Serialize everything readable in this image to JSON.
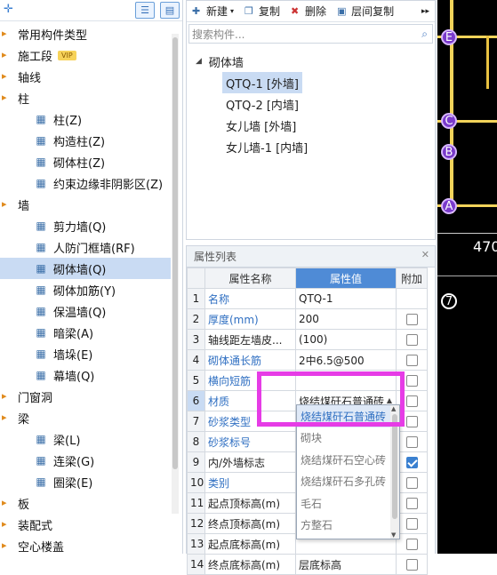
{
  "left_tree": {
    "categories": [
      {
        "label": "常用构件类型"
      },
      {
        "label": "施工段",
        "badge": "VIP"
      },
      {
        "label": "轴线"
      },
      {
        "label": "柱",
        "items": [
          {
            "label": "柱(Z)",
            "icon": "column-icon"
          },
          {
            "label": "构造柱(Z)",
            "icon": "constructional-column-icon"
          },
          {
            "label": "砌体柱(Z)",
            "icon": "masonry-column-icon"
          },
          {
            "label": "约束边缘非阴影区(Z)",
            "icon": "constraint-edge-icon"
          }
        ]
      },
      {
        "label": "墙",
        "items": [
          {
            "label": "剪力墙(Q)",
            "icon": "shear-wall-icon"
          },
          {
            "label": "人防门框墙(RF)",
            "icon": "civil-defense-door-wall-icon"
          },
          {
            "label": "砌体墙(Q)",
            "icon": "masonry-wall-icon",
            "selected": true
          },
          {
            "label": "砌体加筋(Y)",
            "icon": "masonry-reinforcement-icon"
          },
          {
            "label": "保温墙(Q)",
            "icon": "insulation-wall-icon"
          },
          {
            "label": "暗梁(A)",
            "icon": "hidden-beam-icon"
          },
          {
            "label": "墙垛(E)",
            "icon": "wall-buttress-icon"
          },
          {
            "label": "幕墙(Q)",
            "icon": "curtain-wall-icon"
          }
        ]
      },
      {
        "label": "门窗洞"
      },
      {
        "label": "梁",
        "items": [
          {
            "label": "梁(L)",
            "icon": "beam-icon"
          },
          {
            "label": "连梁(G)",
            "icon": "coupling-beam-icon"
          },
          {
            "label": "圈梁(E)",
            "icon": "ring-beam-icon"
          }
        ]
      },
      {
        "label": "板"
      },
      {
        "label": "装配式"
      },
      {
        "label": "空心楼盖"
      }
    ]
  },
  "toolbar": {
    "new_label": "新建",
    "copy_label": "复制",
    "delete_label": "删除",
    "floor_copy_label": "层间复制"
  },
  "search": {
    "placeholder": "搜索构件..."
  },
  "component_tree": {
    "parent": "砌体墙",
    "children": [
      {
        "label": "QTQ-1 [外墙]",
        "selected": true
      },
      {
        "label": "QTQ-2 [内墙]"
      },
      {
        "label": "女儿墙 [外墙]"
      },
      {
        "label": "女儿墙-1 [内墙]"
      }
    ]
  },
  "properties": {
    "title": "属性列表",
    "headers": {
      "name": "属性名称",
      "value": "属性值",
      "extra": "附加"
    },
    "rows": [
      {
        "num": "1",
        "name": "名称",
        "value": "QTQ-1",
        "link": true,
        "check": null
      },
      {
        "num": "2",
        "name": "厚度(mm)",
        "value": "200",
        "link": true,
        "check": false
      },
      {
        "num": "3",
        "name": "轴线距左墙皮...",
        "value": "(100)",
        "link": false,
        "check": false
      },
      {
        "num": "4",
        "name": "砌体通长筋",
        "value": "2中6.5@500",
        "link": true,
        "check": false
      },
      {
        "num": "5",
        "name": "横向短筋",
        "value": "",
        "link": true,
        "check": false
      },
      {
        "num": "6",
        "name": "材质",
        "value": "烧结煤矸石普通砖",
        "link": true,
        "check": false,
        "dropdown": true
      },
      {
        "num": "7",
        "name": "砂浆类型",
        "value": "",
        "link": true,
        "check": false
      },
      {
        "num": "8",
        "name": "砂浆标号",
        "value": "",
        "link": true,
        "check": false
      },
      {
        "num": "9",
        "name": "内/外墙标志",
        "value": "",
        "link": false,
        "check": true
      },
      {
        "num": "10",
        "name": "类别",
        "value": "",
        "link": true,
        "check": false
      },
      {
        "num": "11",
        "name": "起点顶标高(m)",
        "value": "",
        "link": false,
        "check": false
      },
      {
        "num": "12",
        "name": "终点顶标高(m)",
        "value": "",
        "link": false,
        "check": false
      },
      {
        "num": "13",
        "name": "起点底标高(m)",
        "value": "",
        "link": false,
        "check": false
      },
      {
        "num": "14",
        "name": "终点底标高(m)",
        "value": "层底标高",
        "link": false,
        "check": false
      }
    ]
  },
  "material_dropdown": {
    "options": [
      "烧结煤矸石普通砖",
      "砌块",
      "烧结煤矸石空心砖",
      "烧结煤矸石多孔砖",
      "毛石",
      "方整石"
    ],
    "highlighted": 0
  },
  "canvas": {
    "axis_labels": [
      "E",
      "C",
      "B",
      "A",
      "7"
    ],
    "dimension": "470",
    "colors": {
      "background": "#000000",
      "grid": "#f2d35a",
      "axis_marker": "#7a3acb"
    }
  }
}
